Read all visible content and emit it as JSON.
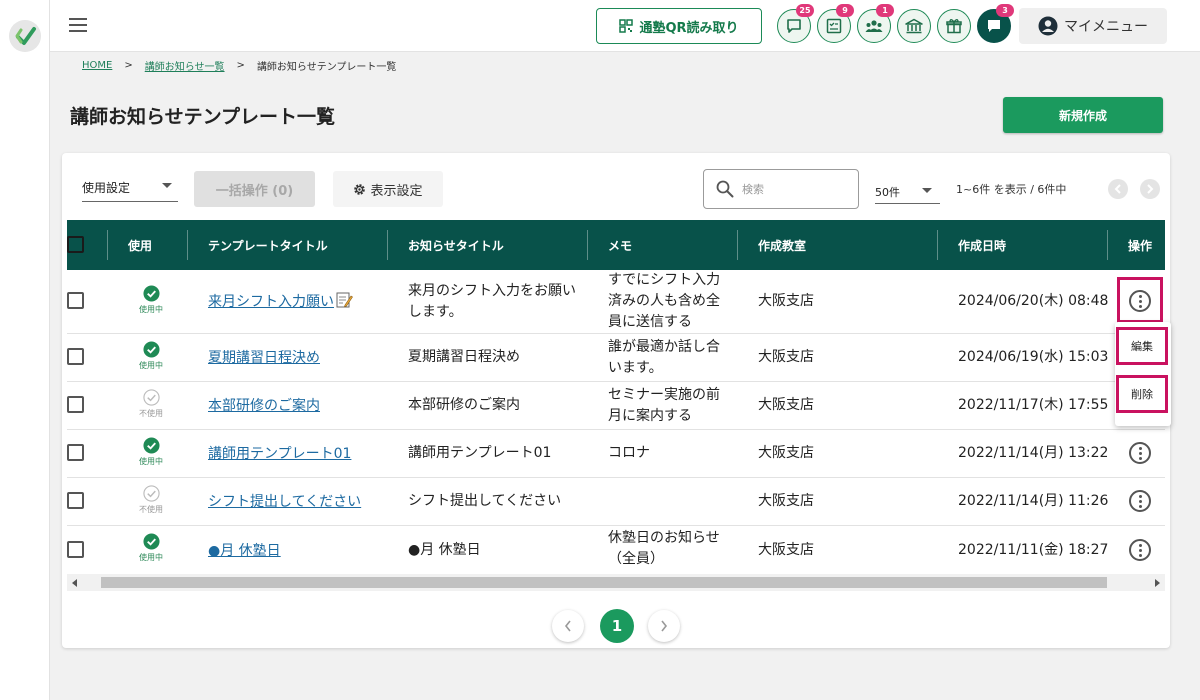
{
  "header": {
    "qr_label": "通塾QR読み取り",
    "badges": {
      "messages": "25",
      "tasks": "9",
      "members": "1",
      "chat": "3"
    },
    "mymenu_label": "マイメニュー"
  },
  "breadcrumb": {
    "home": "HOME",
    "parent": "講師お知らせ一覧",
    "current": "講師お知らせテンプレート一覧",
    "sep": ">"
  },
  "page": {
    "title": "講師お知らせテンプレート一覧",
    "new_button": "新規作成"
  },
  "toolbar": {
    "use_filter": "使用設定",
    "bulk_action": "一括操作 (0)",
    "display_settings": "表示設定",
    "search_placeholder": "検索",
    "per_page": "50件",
    "range_text": "1~6件 を表示 / 6件中"
  },
  "table": {
    "columns": [
      "使用",
      "テンプレートタイトル",
      "お知らせタイトル",
      "メモ",
      "作成教室",
      "作成日時",
      "操作"
    ],
    "rows": [
      {
        "status": "使用中",
        "active": true,
        "template_title": "来月シフト入力願い",
        "notice_title": "来月のシフト入力をお願いします。",
        "memo": "すでにシフト入力済みの人も含め全員に送信する",
        "school": "大阪支店",
        "created": "2024/06/20(木) 08:48"
      },
      {
        "status": "使用中",
        "active": true,
        "template_title": "夏期講習日程決め",
        "notice_title": "夏期講習日程決め",
        "memo": "誰が最適か話し合います。",
        "school": "大阪支店",
        "created": "2024/06/19(水) 15:03"
      },
      {
        "status": "不使用",
        "active": false,
        "template_title": "本部研修のご案内",
        "notice_title": "本部研修のご案内",
        "memo": "セミナー実施の前月に案内する",
        "school": "大阪支店",
        "created": "2022/11/17(木) 17:55"
      },
      {
        "status": "使用中",
        "active": true,
        "template_title": "講師用テンプレート01",
        "notice_title": "講師用テンプレート01",
        "memo": "コロナ",
        "school": "大阪支店",
        "created": "2022/11/14(月) 13:22"
      },
      {
        "status": "不使用",
        "active": false,
        "template_title": "シフト提出してください",
        "notice_title": "シフト提出してください",
        "memo": "",
        "school": "大阪支店",
        "created": "2022/11/14(月) 11:26"
      },
      {
        "status": "使用中",
        "active": true,
        "template_title": "●月 休塾日",
        "notice_title": "●月 休塾日",
        "memo": "休塾日のお知らせ（全員）",
        "school": "大阪支店",
        "created": "2022/11/11(金) 18:27"
      }
    ]
  },
  "row_menu": {
    "edit": "編集",
    "delete": "削除"
  },
  "pagination": {
    "current": "1"
  },
  "colors": {
    "primary_dark": "#08524a",
    "primary": "#1b9a5e",
    "badge": "#e0387a",
    "highlight": "#c9125f",
    "link": "#1d6aa1"
  }
}
